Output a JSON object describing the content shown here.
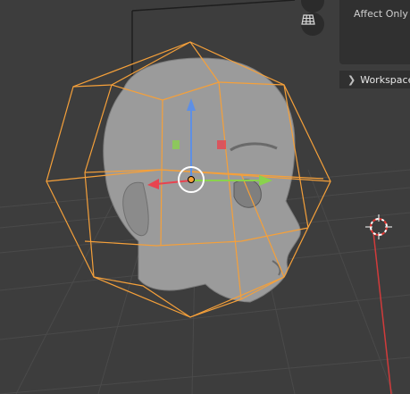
{
  "viewport": {
    "panel": {
      "affect_only_label": "Affect Only"
    },
    "sidebar": {
      "workspace_label": "Workspace",
      "workspace_expanded": false
    },
    "navigation": [
      "camera-view-icon",
      "orthographic-grid-icon"
    ],
    "selection": {
      "object": "head-mesh",
      "mode": "edit-lattice",
      "tool": "move"
    },
    "colors": {
      "background": "#3d3d3d",
      "lattice": "#f5a03a",
      "axis_x": "#e8434f",
      "axis_y": "#8ad24d",
      "axis_z": "#5e8fe5",
      "cursor": "#e53935",
      "panel": "#303030"
    }
  }
}
